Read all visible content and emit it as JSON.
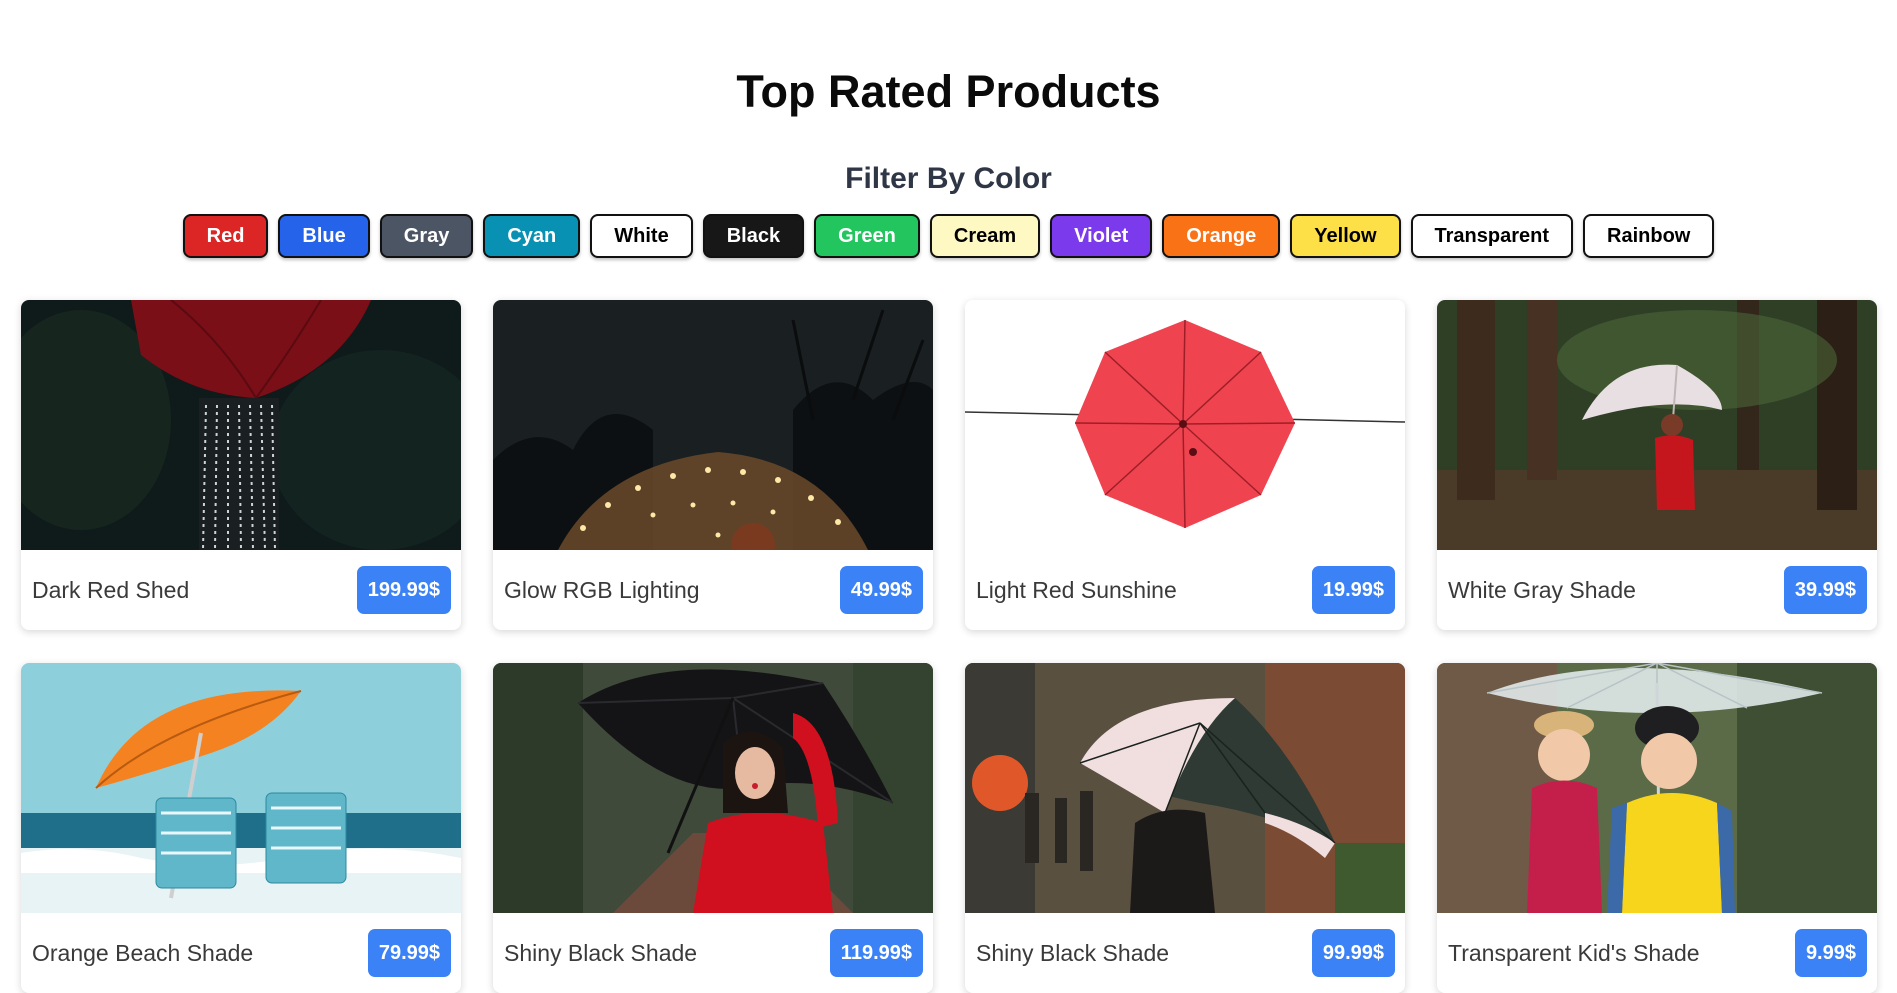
{
  "page": {
    "title": "Top Rated Products",
    "filter_heading": "Filter By Color"
  },
  "filters": [
    {
      "label": "Red",
      "bg": "#dc2626",
      "fg": "#ffffff"
    },
    {
      "label": "Blue",
      "bg": "#2563eb",
      "fg": "#ffffff"
    },
    {
      "label": "Gray",
      "bg": "#4b5563",
      "fg": "#ffffff"
    },
    {
      "label": "Cyan",
      "bg": "#0891b2",
      "fg": "#ffffff"
    },
    {
      "label": "White",
      "bg": "#ffffff",
      "fg": "#000000"
    },
    {
      "label": "Black",
      "bg": "#171717",
      "fg": "#ffffff"
    },
    {
      "label": "Green",
      "bg": "#22c55e",
      "fg": "#ffffff"
    },
    {
      "label": "Cream",
      "bg": "#fef9c3",
      "fg": "#000000"
    },
    {
      "label": "Violet",
      "bg": "#7c3aed",
      "fg": "#ffffff"
    },
    {
      "label": "Orange",
      "bg": "#f97316",
      "fg": "#ffffff"
    },
    {
      "label": "Yellow",
      "bg": "#fde047",
      "fg": "#000000"
    },
    {
      "label": "Transparent",
      "bg": "#ffffff",
      "fg": "#000000"
    },
    {
      "label": "Rainbow",
      "bg": "#ffffff",
      "fg": "#000000"
    }
  ],
  "products": [
    {
      "name": "Dark Red Shed",
      "price": "199.99$",
      "image": "dark-red-umbrella-photo"
    },
    {
      "name": "Glow RGB Lighting",
      "price": "49.99$",
      "image": "glowing-lights-umbrella-photo"
    },
    {
      "name": "Light Red Sunshine",
      "price": "19.99$",
      "image": "light-red-umbrella-photo"
    },
    {
      "name": "White Gray Shade",
      "price": "39.99$",
      "image": "white-umbrella-forest-photo"
    },
    {
      "name": "Orange Beach Shade",
      "price": "79.99$",
      "image": "orange-beach-umbrella-photo"
    },
    {
      "name": "Shiny Black Shade",
      "price": "119.99$",
      "image": "black-umbrella-woman-photo"
    },
    {
      "name": "Shiny Black Shade",
      "price": "99.99$",
      "image": "dark-green-umbrella-street-photo"
    },
    {
      "name": "Transparent Kid's Shade",
      "price": "9.99$",
      "image": "transparent-umbrella-kids-photo"
    }
  ],
  "colors": {
    "price_badge": "#3b82f6",
    "title": "#0a0a0a",
    "filter_heading": "#2f3645"
  }
}
